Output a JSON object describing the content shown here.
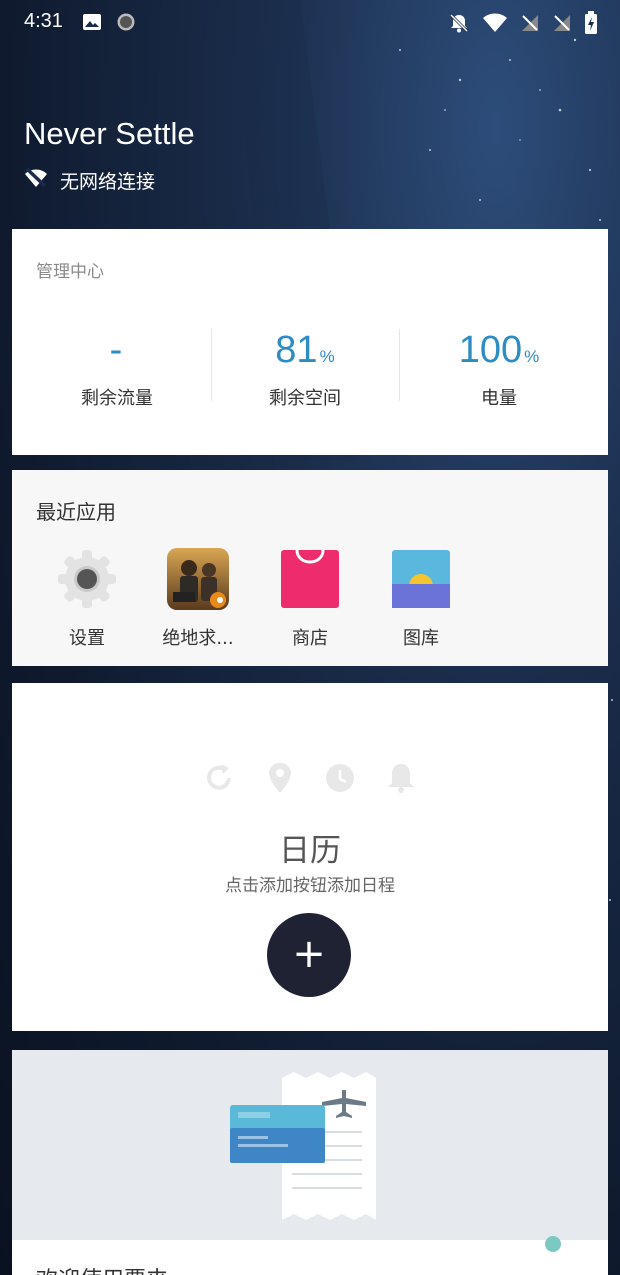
{
  "status_bar": {
    "time": "4:31",
    "left_icons": [
      "image-icon",
      "circle-indicator-icon"
    ],
    "right_icons": [
      "bell-off-icon",
      "wifi-icon",
      "signal-off-icon",
      "signal-off-icon-2",
      "battery-charging-icon"
    ]
  },
  "header": {
    "title": "Never Settle",
    "network_status": "无网络连接",
    "network_icon": "wifi-off-icon"
  },
  "management": {
    "title": "管理中心",
    "stats": [
      {
        "value": "-",
        "unit": "",
        "label": "剩余流量"
      },
      {
        "value": "81",
        "unit": "%",
        "label": "剩余空间"
      },
      {
        "value": "100",
        "unit": "%",
        "label": "电量"
      }
    ],
    "accent_color": "#2d8cc4"
  },
  "recent_apps": {
    "title": "最近应用",
    "apps": [
      {
        "label": "设置",
        "icon": "gear-icon"
      },
      {
        "label": "绝地求...",
        "icon": "game-icon"
      },
      {
        "label": "商店",
        "icon": "shopping-bag-icon"
      },
      {
        "label": "图库",
        "icon": "gallery-icon"
      }
    ]
  },
  "calendar": {
    "icons": [
      "refresh-icon",
      "location-pin-icon",
      "clock-icon",
      "bell-icon"
    ],
    "title": "日历",
    "subtitle": "点击添加按钮添加日程",
    "add_label": "+"
  },
  "welcome": {
    "title": "欢迎使用票夹"
  }
}
